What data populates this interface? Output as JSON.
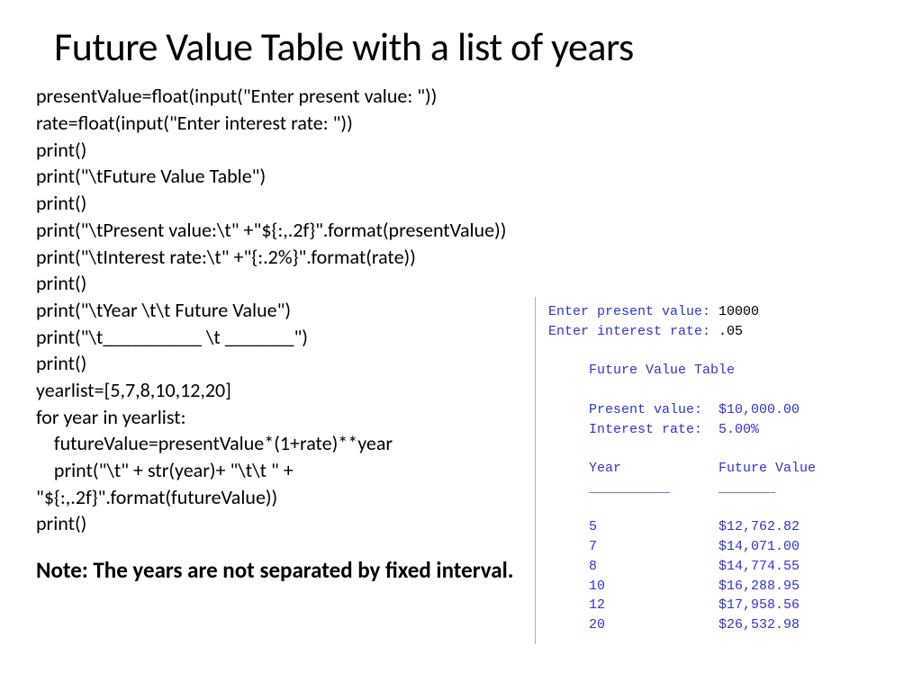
{
  "title": "Future Value Table with a list of years",
  "code_lines": [
    "presentValue=float(input(\"Enter present value: \"))",
    "rate=float(input(\"Enter interest rate: \"))",
    "print()",
    "print(\"\\tFuture Value Table\")",
    "print()",
    "print(\"\\tPresent value:\\t\" +\"${:,.2f}\".format(presentValue))",
    "print(\"\\tInterest rate:\\t\" +\"{:.2%}\".format(rate))",
    "print()",
    "print(\"\\tYear \\t\\t Future Value\")",
    "print(\"\\t__________ \\t _______\")",
    "print()",
    "yearlist=[5,7,8,10,12,20]",
    "for year in yearlist:",
    "    futureValue=presentValue*(1+rate)**year",
    "    print(\"\\t\" + str(year)+ \"\\t\\t \" +",
    "\"${:,.2f}\".format(futureValue))",
    "print()"
  ],
  "note": "Note: The years are not separated by fixed interval.",
  "output": {
    "prompt1_label": "Enter present value: ",
    "prompt1_input": "10000",
    "prompt2_label": "Enter interest rate: ",
    "prompt2_input": ".05",
    "table_title": "Future Value Table",
    "present_value_label": "Present value:",
    "present_value": "$10,000.00",
    "interest_rate_label": "Interest rate:",
    "interest_rate": "5.00%",
    "col1_header": "Year",
    "col2_header": "Future Value",
    "rule1": "__________",
    "rule2": "_______",
    "rows": [
      {
        "year": "5",
        "fv": "$12,762.82"
      },
      {
        "year": "7",
        "fv": "$14,071.00"
      },
      {
        "year": "8",
        "fv": "$14,774.55"
      },
      {
        "year": "10",
        "fv": "$16,288.95"
      },
      {
        "year": "12",
        "fv": "$17,958.56"
      },
      {
        "year": "20",
        "fv": "$26,532.98"
      }
    ]
  }
}
